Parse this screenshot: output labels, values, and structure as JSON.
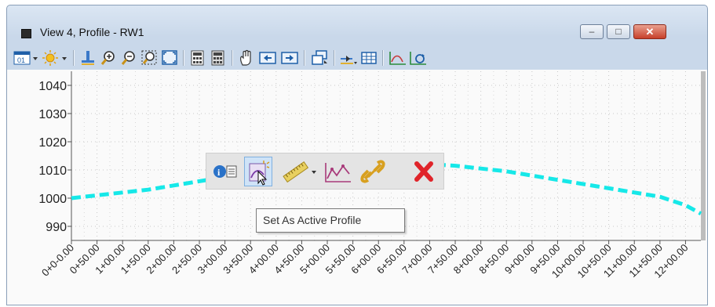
{
  "window": {
    "title": "View 4, Profile - RW1",
    "minimize_glyph": "–",
    "maximize_glyph": "□",
    "close_glyph": "✕"
  },
  "toolbar_icons": [
    "view-attributes-icon",
    "lighting-icon",
    "rotate-view-icon",
    "zoom-in-icon",
    "zoom-out-icon",
    "window-area-icon",
    "fit-view-icon",
    "update-view-icon",
    "view-display-icon",
    "pan-icon",
    "previous-view-icon",
    "next-view-icon",
    "copy-view-icon",
    "clip-volume-icon",
    "grid-icon",
    "profile-exaggeration-icon",
    "refresh-profile-icon"
  ],
  "chart_data": {
    "type": "line",
    "ylim": [
      985,
      1045
    ],
    "y_ticks": [
      "1040",
      "1030",
      "1020",
      "1010",
      "1000",
      "990"
    ],
    "y_tick_values": [
      1040,
      1030,
      1020,
      1010,
      1000,
      990
    ],
    "xlim": [
      0,
      1230
    ],
    "x_ticks": [
      "0+0-0.00",
      "0+50.00",
      "1+00.00",
      "1+50.00",
      "2+00.00",
      "2+50.00",
      "3+00.00",
      "3+50.00",
      "4+00.00",
      "4+50.00",
      "5+00.00",
      "5+50.00",
      "6+00.00",
      "6+50.00",
      "7+00.00",
      "7+50.00",
      "8+00.00",
      "8+50.00",
      "9+00.00",
      "9+50.00",
      "10+00.00",
      "10+50.00",
      "11+00.00",
      "11+50.00",
      "12+00.00"
    ],
    "x_tick_values": [
      0,
      50,
      100,
      150,
      200,
      250,
      300,
      350,
      400,
      450,
      500,
      550,
      600,
      650,
      700,
      750,
      800,
      850,
      900,
      950,
      1000,
      1050,
      1100,
      1150,
      1200
    ],
    "grid": true,
    "series": [
      {
        "color": "#16e8e8",
        "dashed": true,
        "x": [
          0,
          50,
          100,
          150,
          200,
          250,
          300,
          350,
          400,
          450,
          500,
          550,
          600,
          650,
          700,
          750,
          800,
          850,
          900,
          950,
          1000,
          1050,
          1100,
          1150,
          1200,
          1230
        ],
        "y": [
          1000,
          1001,
          1002,
          1003,
          1004.5,
          1006,
          1007.5,
          1009,
          1010.5,
          1011.5,
          1012,
          1012.3,
          1012.4,
          1012.3,
          1012,
          1011.5,
          1010.5,
          1009.5,
          1008,
          1006.5,
          1005,
          1003.5,
          1002,
          1000.5,
          997.5,
          994.5
        ]
      }
    ]
  },
  "popup_icons": [
    "element-info-icon",
    "set-active-profile-icon",
    "measure-icon",
    "profile-tools-icon",
    "link-icon",
    "delete-icon"
  ],
  "tooltip": {
    "text": "Set As Active Profile"
  }
}
